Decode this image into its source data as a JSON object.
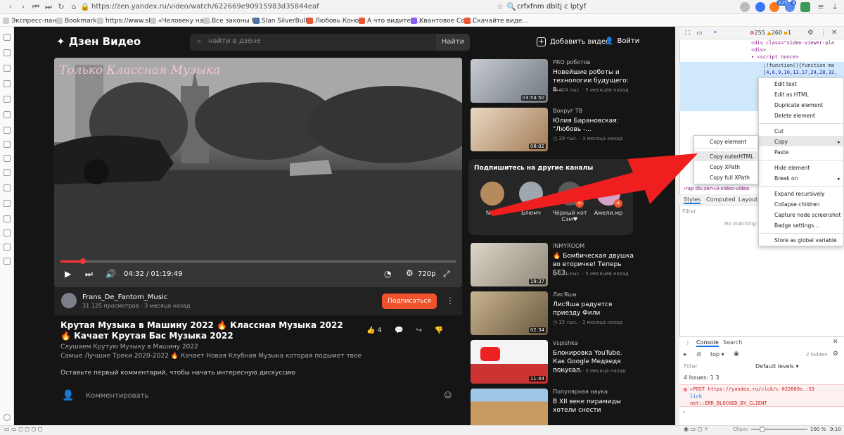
{
  "browser": {
    "url": "https://zen.yandex.ru/video/watch/622669e90915983d35844eaf",
    "search_query": "crfxfnm dbltj c lptyf",
    "bookmarks": [
      "Экспресс-пан...",
      "Bookmarks",
      "https://www.sb...",
      "«Человеку над...",
      "Все законы М...",
      "Slan SilverBulle...",
      "Любовь Коно...",
      "А что видите в...",
      "Квантовое Соз...",
      "Скачайте виде..."
    ],
    "badges": [
      "225",
      "3"
    ]
  },
  "header": {
    "logo": "Дзен Видео",
    "search_placeholder": "найти в дзене",
    "search_button": "Найти",
    "add_video": "Добавить видео",
    "login": "Войти"
  },
  "video": {
    "watermark": "Только Классная Музыка",
    "time": "04:32 / 01:19:49",
    "quality": "720p",
    "progress": 0.05,
    "channel_name": "Frans_De_Fantom_Music",
    "channel_stats": "31 125 просмотров · 3 месяца назад",
    "subscribe": "Подписаться",
    "title": "Крутая Музыка в Машину 2022 🔥 Классная Музыка 2022 🔥 Качает Крутая Бас Музыка 2022",
    "likes": "4",
    "desc1": "Слушаем Крутую Музыку в Машину 2022",
    "desc2": "Самые Лучшие Треки 2020-2022 🔥 Качает Новая Клубная Музыка которая подымет твое",
    "no_comments": "Оставьте первый комментарий, чтобы начать интересную дискуссию",
    "comment_placeholder": "Комментировать"
  },
  "recs": [
    {
      "source": "PRO роботов",
      "title": "Новейшие роботы и технологии будущего: в...",
      "meta": "◷ 424 тыс. · 5 месяцев назад",
      "duration": "03:54:50",
      "color": "#9aa3ad"
    },
    {
      "source": "Вокруг ТВ",
      "title": "Юлия Барановская: \"Любовь -...",
      "meta": "◷ 29 тыс. · 3 месяца назад",
      "duration": "08:02",
      "color": "#c9a07a"
    },
    {
      "source": "INMYROOM",
      "title": "🔥 Бомбическая двушка во вторичке! Теперь БЕЗ...",
      "meta": "◷ 121 тыс. · 5 месяцев назад",
      "duration": "19:37",
      "color": "#b8b1a4"
    },
    {
      "source": "ЛисЯша",
      "title": "ЛисЯша радуется приезду Фили",
      "meta": "◷ 15 тыс. · 3 месяца назад",
      "duration": "02:34",
      "color": "#8d7a5e"
    },
    {
      "source": "Vspishka",
      "title": "Блокировка YouTube. Как Google Медведя покусал.",
      "meta": "◷ 165 тыс. · 3 месяца назад",
      "duration": "11:44",
      "color": "#d93025"
    },
    {
      "source": "Популярная наука",
      "title": "В XII веке пирамиды хотели снести",
      "meta": "",
      "duration": "",
      "color": "#b88a55"
    }
  ],
  "subscribe_panel": {
    "heading": "Подпишитесь на другие каналы",
    "channels": [
      {
        "name": "Nani",
        "color": "#b58b5d"
      },
      {
        "name": "Блюмч",
        "color": "#9ea6b0"
      },
      {
        "name": "Чёрный кот Сэм♥",
        "color": "#5a5a5a"
      },
      {
        "name": "Амели.мр",
        "color": "#d6a3c8"
      }
    ]
  },
  "devtools": {
    "errors": "255",
    "warnings": "260",
    "info": "1",
    "code": [
      "<div class=\"video-viewer-pla",
      "<div>",
      "▾ <script nonce>",
      ";!function(){function ma",
      "[4,6,9,10,13,17,24,28,33,"
    ],
    "breadcrumb": "div.zen-ui-video-video",
    "tabs": [
      "Styles",
      "Computed",
      "Layout"
    ],
    "filter": "Filter",
    "no_matching": "No matching s",
    "console_tabs": [
      "Console",
      "Search"
    ],
    "context": "top ▾",
    "default_levels": "Default levels ▾",
    "hidden": "2 hidden",
    "issues": "4 Issues: 1 3",
    "error_line1": "▸POST https://yandex.ru/clck/c 622669e.:53",
    "error_line2": "lick",
    "error_line3": "net::ERR_BLOCKED_BY_CLIENT"
  },
  "context_menu_main": [
    "Edit text",
    "Edit as HTML",
    "Duplicate element",
    "Delete element",
    "Cut",
    "Copy",
    "Paste",
    "Hide element",
    "Break on",
    "Expand recursively",
    "Collapse children",
    "Capture node screenshot",
    "Badge settings...",
    "Store as global variable"
  ],
  "context_menu_copy": [
    "Copy element",
    "Copy outerHTML",
    "Copy XPath",
    "Copy full XPath"
  ],
  "statusbar": {
    "reset": "Сброс",
    "zoom": "100 %",
    "clock": "9:10"
  },
  "colors": {
    "accent": "#f0522c",
    "page_bg": "#151515",
    "arrow": "#f22"
  }
}
